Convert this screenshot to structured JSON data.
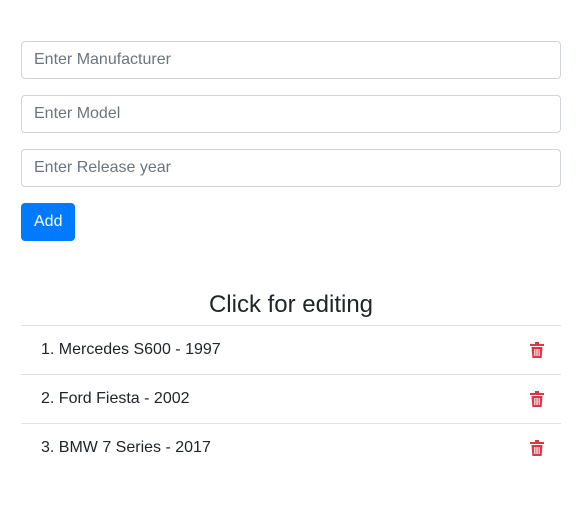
{
  "form": {
    "manufacturer": {
      "value": "",
      "placeholder": "Enter Manufacturer"
    },
    "model": {
      "value": "",
      "placeholder": "Enter Model"
    },
    "release_year": {
      "value": "",
      "placeholder": "Enter Release year"
    },
    "add_label": "Add"
  },
  "list": {
    "title": "Click for editing",
    "items": [
      {
        "label": "1. Mercedes S600 - 1997",
        "delete_icon": "trash-icon"
      },
      {
        "label": "2. Ford Fiesta - 2002",
        "delete_icon": "trash-icon"
      },
      {
        "label": "3. BMW 7 Series - 2017",
        "delete_icon": "trash-icon"
      }
    ]
  },
  "colors": {
    "primary": "#007bff",
    "danger": "#dc3545",
    "border": "#dee2e6",
    "input_border": "#ced4da"
  }
}
